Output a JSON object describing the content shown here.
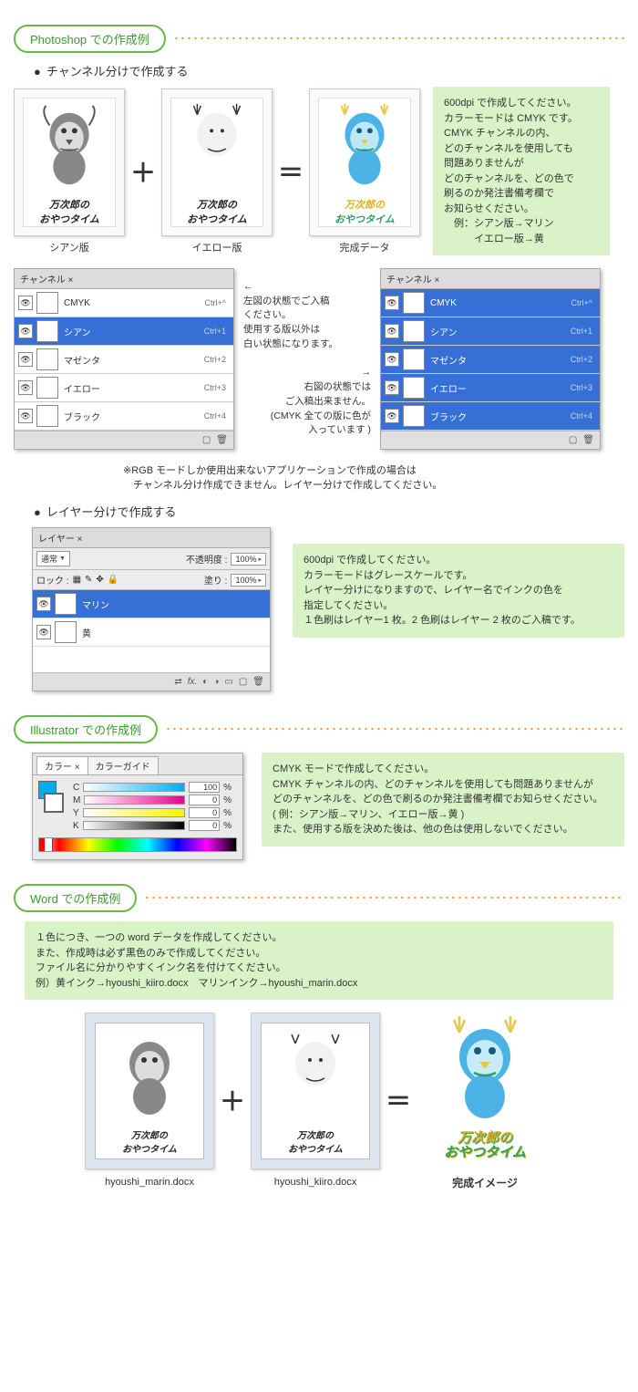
{
  "sections": {
    "photoshop": "Photoshop での作成例",
    "illustrator": "Illustrator での作成例",
    "word": "Word での作成例"
  },
  "sub": {
    "channel_split": "チャンネル分けで作成する",
    "layer_split": "レイヤー分けで作成する"
  },
  "plates": {
    "cyan": "シアン版",
    "yellow": "イエロー版",
    "final": "完成データ",
    "plus": "＋",
    "equals": "＝"
  },
  "artwork": {
    "line1": "万次郎の",
    "line2": "おやつタイム"
  },
  "green_box1": {
    "l1": "600dpi で作成してください。",
    "l2": "カラーモードは CMYK です。",
    "l3": "CMYK チャンネルの内、",
    "l4": "どのチャンネルを使用しても",
    "l5": "問題ありませんが",
    "l6": "どのチャンネルを、どの色で",
    "l7": "刷るのか発注書備考欄で",
    "l8": "お知らせください。",
    "l9": "　例：シアン版→マリン",
    "l10": "　　　イエロー版→黄"
  },
  "channels_panel": {
    "title": "チャンネル ×",
    "items": [
      {
        "name": "CMYK",
        "shortcut": "Ctrl+^"
      },
      {
        "name": "シアン",
        "shortcut": "Ctrl+1"
      },
      {
        "name": "マゼンタ",
        "shortcut": "Ctrl+2"
      },
      {
        "name": "イエロー",
        "shortcut": "Ctrl+3"
      },
      {
        "name": "ブラック",
        "shortcut": "Ctrl+4"
      }
    ]
  },
  "center_notes": {
    "left_arrow": "←",
    "left1": "左図の状態でご入稿",
    "left2": "ください。",
    "left3": "使用する版以外は",
    "left4": "白い状態になります。",
    "right_arrow": "→",
    "right1": "右図の状態では",
    "right2": "ご入稿出来ません。",
    "right3": "(CMYK 全ての版に色が",
    "right4": "入っています )"
  },
  "rgb_note": {
    "l1": "※RGB モードしか使用出来ないアプリケーションで作成の場合は",
    "l2": "　チャンネル分け作成できません。レイヤー分けで作成してください。"
  },
  "layers_panel": {
    "title": "レイヤー ×",
    "mode": "通常",
    "opacity_label": "不透明度 :",
    "opacity_val": "100%",
    "lock_label": "ロック :",
    "fill_label": "塗り :",
    "fill_val": "100%",
    "layers": [
      {
        "name": "マリン"
      },
      {
        "name": "黄"
      }
    ]
  },
  "green_box2": {
    "l1": "600dpi で作成してください。",
    "l2": "カラーモードはグレースケールです。",
    "l3": "レイヤー分けになりますので、レイヤー名でインクの色を",
    "l4": "指定してください。",
    "l5": "１色刷はレイヤー1 枚。2 色刷はレイヤー 2 枚のご入稿です。"
  },
  "color_panel": {
    "tab1": "カラー ×",
    "tab2": "カラーガイド",
    "c_label": "C",
    "c_val": "100",
    "m_label": "M",
    "m_val": "0",
    "y_label": "Y",
    "y_val": "0",
    "k_label": "K",
    "k_val": "0",
    "pct": "%"
  },
  "green_box3": {
    "l1": "CMYK モードで作成してください。",
    "l2": "CMYK チャンネルの内、どのチャンネルを使用しても問題ありませんが",
    "l3": "どのチャンネルを、どの色で刷るのか発注書備考欄でお知らせください。",
    "l4": "( 例：シアン版→マリン、イエロー版→黄 )",
    "l5": "また、使用する版を決めた後は、他の色は使用しないでください。"
  },
  "green_box4": {
    "l1": "１色につき、一つの word データを作成してください。",
    "l2": "また、作成時は必ず黒色のみで作成してください。",
    "l3": "ファイル名に分かりやすくインク名を付けてください。",
    "l4": "例）黄インク→hyoushi_kiiro.docx　マリンインク→hyoushi_marin.docx"
  },
  "word_files": {
    "f1": "hyoushi_marin.docx",
    "f2": "hyoushi_kiiro.docx",
    "final": "完成イメージ"
  }
}
